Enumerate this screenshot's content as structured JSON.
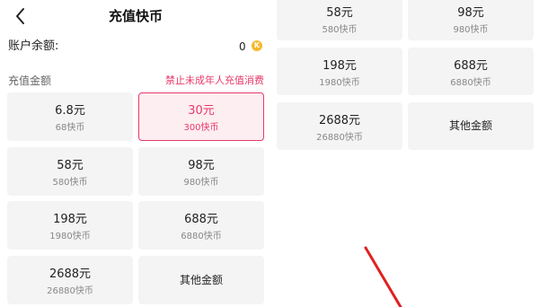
{
  "header": {
    "title": "充值快币"
  },
  "balance": {
    "label": "账户余额:",
    "value": "0",
    "coin_symbol": "K"
  },
  "recharge": {
    "section_label": "充值金额",
    "notice": "禁止未成年人充值消费",
    "options": [
      {
        "amount": "6.8元",
        "coins": "68快币"
      },
      {
        "amount": "30元",
        "coins": "300快币"
      },
      {
        "amount": "58元",
        "coins": "580快币"
      },
      {
        "amount": "98元",
        "coins": "980快币"
      },
      {
        "amount": "198元",
        "coins": "1980快币"
      },
      {
        "amount": "688元",
        "coins": "6880快币"
      },
      {
        "amount": "2688元",
        "coins": "26880快币"
      }
    ],
    "other_label": "其他金额"
  },
  "colors": {
    "accent": "#e8396b",
    "card_bg": "#f4f4f4",
    "coin": "#f5b92d",
    "annotation": "#e02020"
  }
}
